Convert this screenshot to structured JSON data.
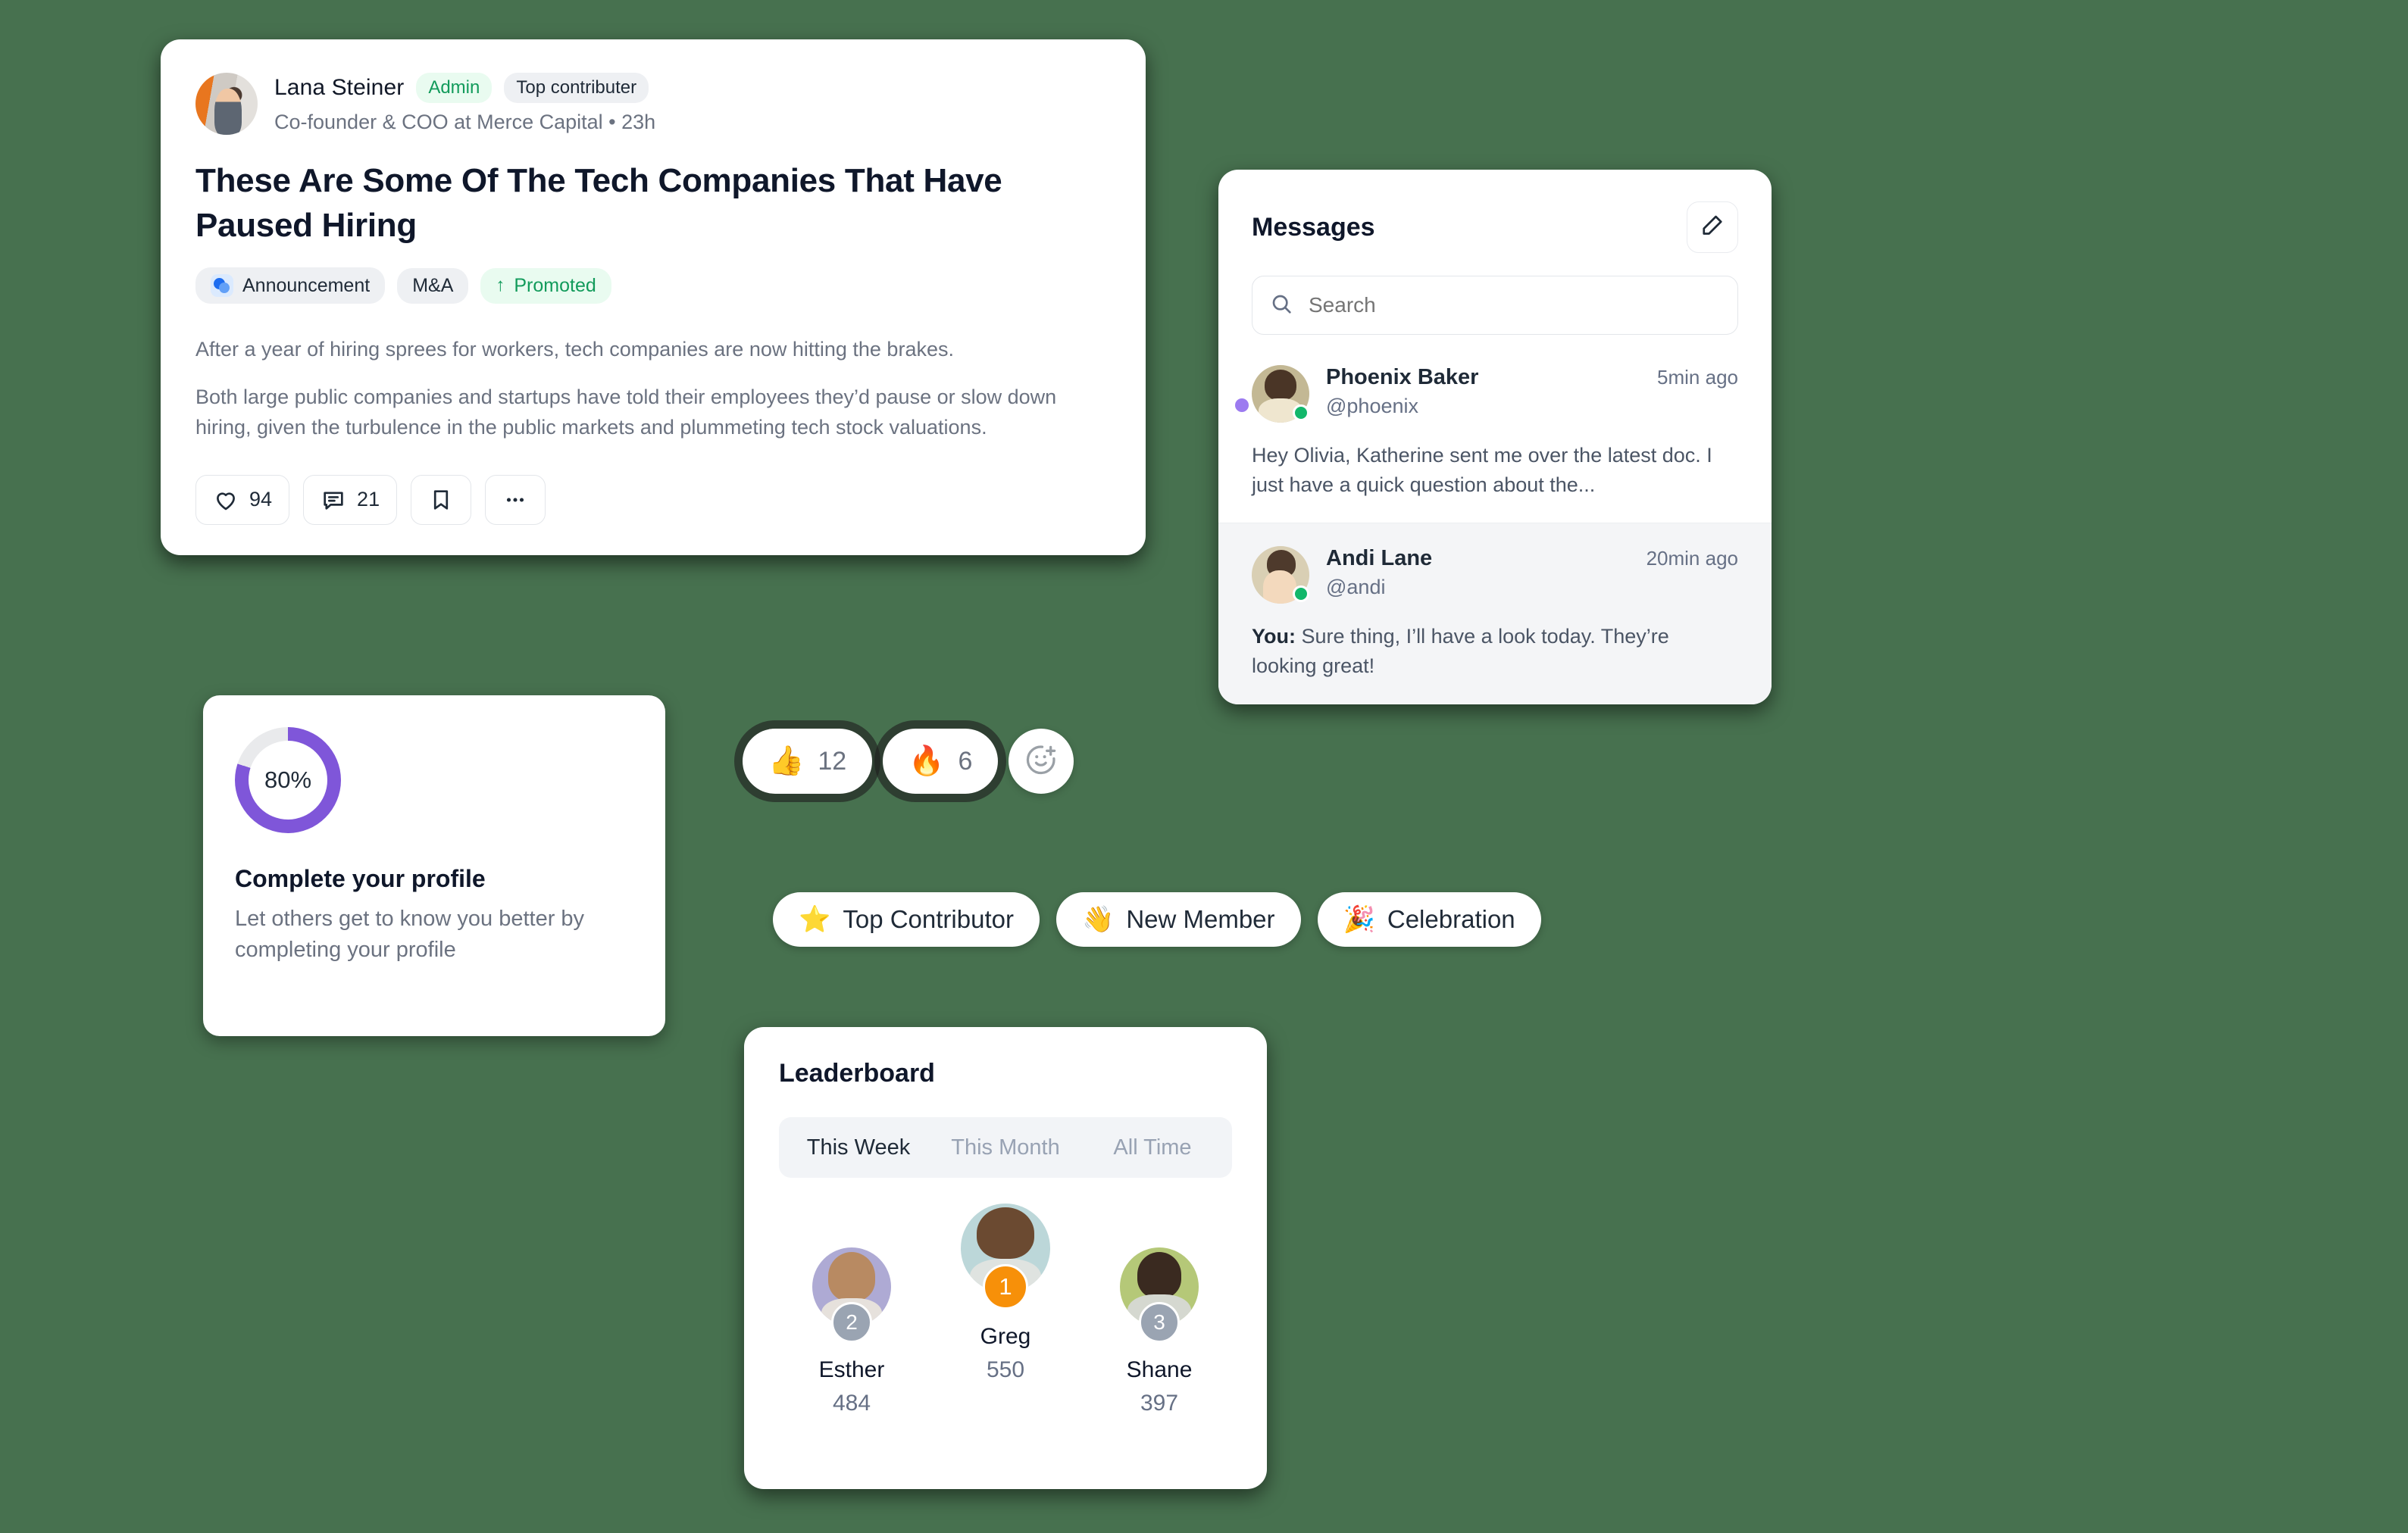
{
  "post": {
    "author": {
      "name": "Lana Steiner",
      "badge_admin": "Admin",
      "badge_contributor": "Top contributer",
      "subtitle": "Co-founder & COO at Merce Capital  •  23h",
      "avatar_name": "lana-steiner-avatar"
    },
    "title": "These Are Some Of The Tech Companies That Have Paused Hiring",
    "tags": [
      {
        "label": "Announcement",
        "icon": "announcement-dots-icon"
      },
      {
        "label": "M&A",
        "icon": ""
      },
      {
        "label": "Promoted",
        "icon": "arrow-up-icon"
      }
    ],
    "paragraph_1": "After a year of hiring sprees for workers, tech companies are now hitting the brakes.",
    "paragraph_2": "Both large public companies and startups have told their employees they’d pause or slow down hiring, given the turbulence in the public markets and plummeting tech stock valuations.",
    "actions": {
      "like_count": "94",
      "comment_count": "21",
      "bookmark_icon": "bookmark-icon",
      "more_icon": "ellipsis-icon"
    }
  },
  "messages": {
    "title": "Messages",
    "compose_icon": "compose-pencil-icon",
    "search": {
      "placeholder": "Search",
      "value": "",
      "icon": "search-icon"
    },
    "items": [
      {
        "name": "Phoenix Baker",
        "handle": "@phoenix",
        "time": "5min ago",
        "preview": "Hey Olivia, Katherine sent me over the latest doc. I just have a quick question about the...",
        "unread": true,
        "online": true,
        "selected": false
      },
      {
        "name": "Andi Lane",
        "handle": "@andi",
        "time": "20min ago",
        "preview_prefix": "You:",
        "preview": "Sure thing, I’ll have a look today. They’re looking great!",
        "unread": false,
        "online": true,
        "selected": true
      }
    ]
  },
  "profile": {
    "percent_label": "80%",
    "percent_value": 80,
    "title": "Complete your profile",
    "subtitle": "Let others get to know you better by completing your profile",
    "ring_color": "#7f56d9",
    "ring_track_color": "#e9eaec"
  },
  "reactions": {
    "items": [
      {
        "emoji": "👍",
        "count": "12",
        "icon": "thumbs-up-emoji"
      },
      {
        "emoji": "🔥",
        "count": "6",
        "icon": "fire-emoji"
      }
    ],
    "add_icon": "add-reaction-smiley-icon"
  },
  "badges": [
    {
      "emoji": "⭐",
      "label": "Top Contributor"
    },
    {
      "emoji": "👋",
      "label": "New Member"
    },
    {
      "emoji": "🎉",
      "label": "Celebration"
    }
  ],
  "leaderboard": {
    "title": "Leaderboard",
    "tabs": [
      {
        "label": "This Week",
        "active": true
      },
      {
        "label": "This Month",
        "active": false
      },
      {
        "label": "All Time",
        "active": false
      }
    ],
    "podium": [
      {
        "rank": "1",
        "name": "Greg",
        "score": "550",
        "rank_color": "#f79009"
      },
      {
        "rank": "2",
        "name": "Esther",
        "score": "484",
        "rank_color": "#9aa4b2"
      },
      {
        "rank": "3",
        "name": "Shane",
        "score": "397",
        "rank_color": "#9aa4b2"
      }
    ]
  },
  "theme": {
    "page_background": "#47714f",
    "accent_purple": "#7f56d9",
    "online_green": "#12b76a"
  }
}
